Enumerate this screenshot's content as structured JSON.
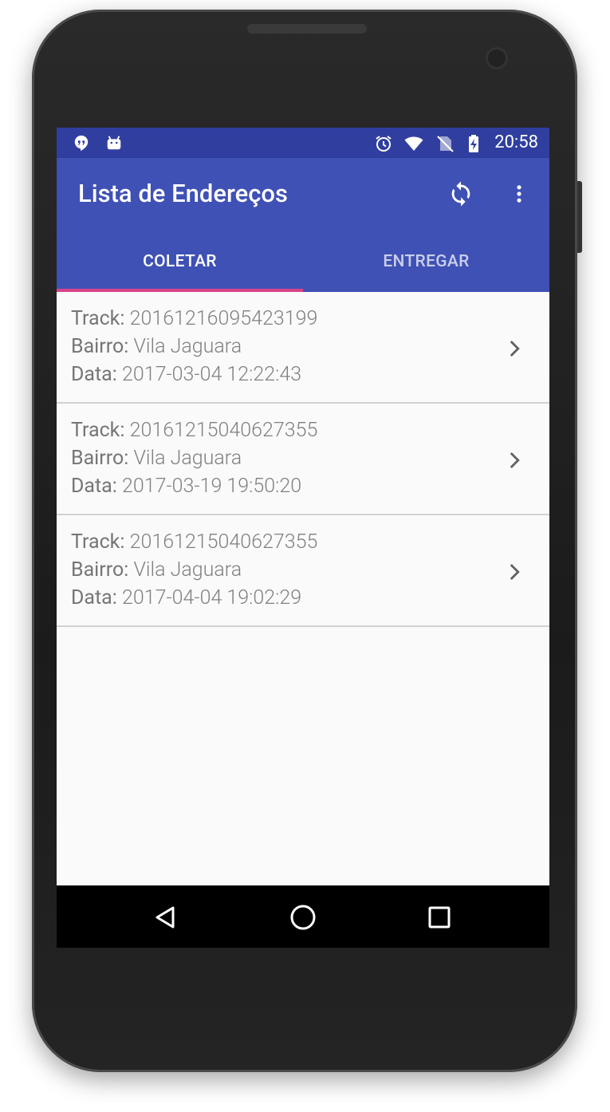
{
  "status_bar": {
    "time": "20:58",
    "left_icons": [
      "hangouts-icon",
      "android-debug-icon"
    ],
    "right_icons": [
      "alarm-icon",
      "wifi-icon",
      "no-sim-icon",
      "battery-charging-icon"
    ]
  },
  "app_bar": {
    "title": "Lista de Endereços",
    "actions": [
      "refresh-icon",
      "more-vert-icon"
    ]
  },
  "tabs": [
    {
      "label": "COLETAR",
      "active": true
    },
    {
      "label": "ENTREGAR",
      "active": false
    }
  ],
  "items": [
    {
      "track_label": "Track:",
      "track": "20161216095423199",
      "bairro_label": "Bairro:",
      "bairro": "Vila Jaguara",
      "data_label": "Data:",
      "data": "2017-03-04 12:22:43"
    },
    {
      "track_label": "Track:",
      "track": "20161215040627355",
      "bairro_label": "Bairro:",
      "bairro": "Vila Jaguara",
      "data_label": "Data:",
      "data": "2017-03-19 19:50:20"
    },
    {
      "track_label": "Track:",
      "track": "20161215040627355",
      "bairro_label": "Bairro:",
      "bairro": "Vila Jaguara",
      "data_label": "Data:",
      "data": "2017-04-04 19:02:29"
    }
  ],
  "nav_bar": [
    "back-icon",
    "home-icon",
    "recents-icon"
  ],
  "colors": {
    "status_bar": "#303f9f",
    "app_bar": "#3f51b5",
    "tab_indicator": "#ff4081",
    "list_background": "#fafafa"
  }
}
